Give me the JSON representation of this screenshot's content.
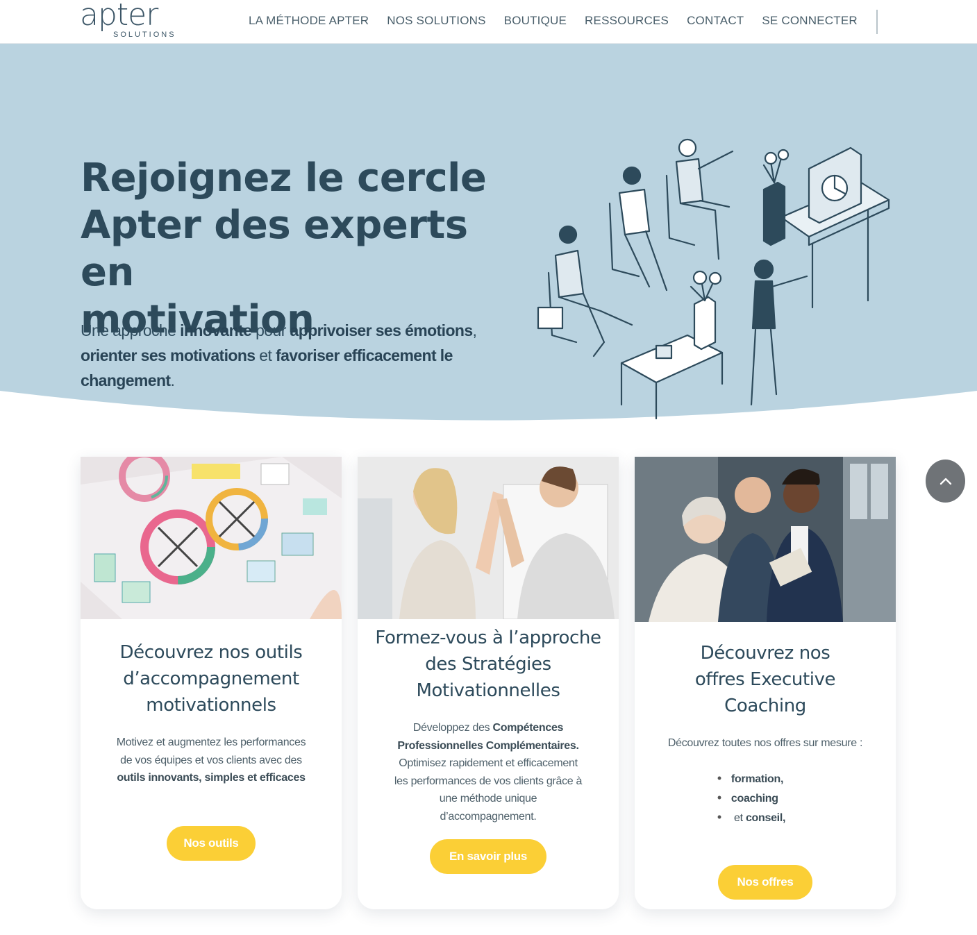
{
  "header": {
    "logo_word": "apter",
    "logo_sub": "SOLUTIONS",
    "nav": [
      {
        "label": "LA MÉTHODE APTER"
      },
      {
        "label": "NOS SOLUTIONS"
      },
      {
        "label": "BOUTIQUE"
      },
      {
        "label": "RESSOURCES"
      },
      {
        "label": "CONTACT"
      },
      {
        "label": "SE CONNECTER"
      }
    ]
  },
  "hero": {
    "title_line1": "Rejoignez le cercle",
    "title_line2": "Apter des experts en",
    "title_line3": "motivation",
    "text": {
      "t1": "Une approche ",
      "b1": "innovante",
      "t2": " pour ",
      "b2": "apprivoiser ses émotions",
      "t3": ",",
      "b3": "orienter ses motivations",
      "t4": " et ",
      "b4": "favoriser efficacement le changement",
      "t5": "."
    },
    "illustration_icon": "team-meeting-illustration"
  },
  "cards": [
    {
      "title": "Découvrez nos outils d’accompagnement motivationnels",
      "text_1": "Motivez et augmentez les performances de vos équipes et vos clients avec des ",
      "text_bold": "outils innovants, simples et efficaces",
      "button": "Nos outils"
    },
    {
      "title": "Formez-vous à l’approche des Stratégies Motivationnelles",
      "text_1": "Développez des ",
      "text_bold": "Compétences Professionnelles Complémentaires.",
      "text_2": "Optimisez rapidement et efficacement les performances de vos clients grâce à une méthode unique d’accompagnement.",
      "button": "En savoir plus"
    },
    {
      "title": "Découvrez nos offres Executive Coaching",
      "text_1": "Découvrez toutes nos offres  sur mesure :",
      "bullet_1": "formation,",
      "bullet_2": "coaching",
      "bullet_3_pre": " et ",
      "bullet_3_bold": "conseil,",
      "button": "Nos offres"
    }
  ],
  "colors": {
    "hero_bg": "#bad3e0",
    "title": "#2d4a5b",
    "button": "#fbcf36",
    "to_top": "#6f7377"
  },
  "to_top_icon": "chevron-up-icon"
}
